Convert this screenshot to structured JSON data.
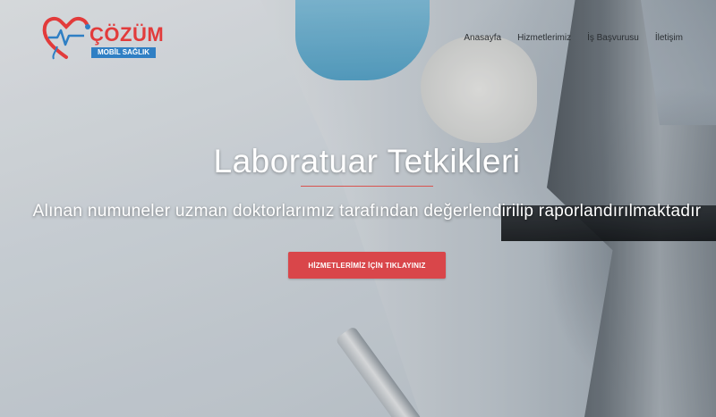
{
  "header": {
    "logo": {
      "name": "ÇÖZÜM",
      "tagline": "MOBİL SAĞLIK"
    },
    "nav": [
      {
        "label": "Anasayfa"
      },
      {
        "label": "Hizmetlerimiz"
      },
      {
        "label": "İş Başvurusu"
      },
      {
        "label": "İletişim"
      }
    ]
  },
  "hero": {
    "title": "Laboratuar Tetkikleri",
    "subtitle": "Alınan numuneler uzman doktorlarımız tarafından değerlendirilip raporlandırılmaktadır",
    "cta_label": "HİZMETLERİMİZ İÇİN TIKLAYINIZ"
  },
  "colors": {
    "accent": "#d9464a",
    "logo_red": "#e23b3b",
    "logo_blue": "#2f7fc4"
  }
}
